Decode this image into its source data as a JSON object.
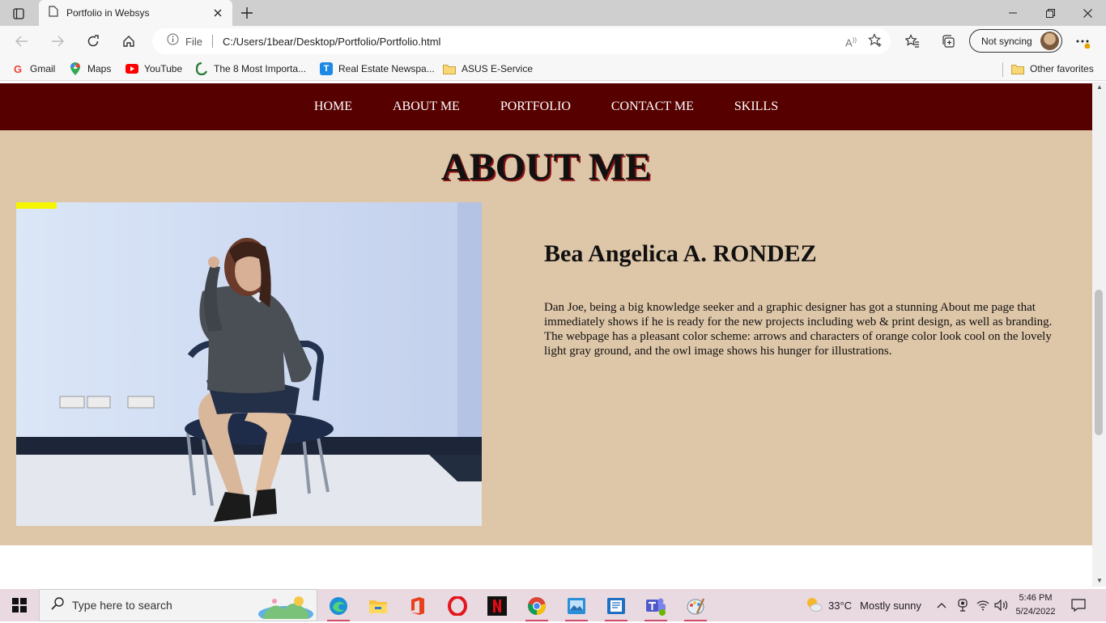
{
  "browser": {
    "tab_title": "Portfolio in Websys",
    "address_scheme": "File",
    "address_url": "C:/Users/1bear/Desktop/Portfolio/Portfolio.html",
    "sync_label": "Not syncing",
    "bookmarks": [
      {
        "label": "Gmail",
        "icon": "gmail-icon"
      },
      {
        "label": "Maps",
        "icon": "maps-icon"
      },
      {
        "label": "YouTube",
        "icon": "youtube-icon"
      },
      {
        "label": "The 8 Most Importa...",
        "icon": "site-icon"
      },
      {
        "label": "Real Estate Newspa...",
        "icon": "t-icon"
      },
      {
        "label": "ASUS E-Service",
        "icon": "folder-icon"
      }
    ],
    "other_favorites": "Other favorites"
  },
  "site": {
    "nav": [
      "HOME",
      "ABOUT ME",
      "PORTFOLIO",
      "CONTACT ME",
      "SKILLS"
    ],
    "about": {
      "title": "ABOUT ME",
      "name": "Bea Angelica A. RONDEZ",
      "bio": "Dan Joe, being a big knowledge seeker and a graphic designer has got a stunning About me page that immediately shows if he is ready for the new projects including web & print design, as well as branding. The webpage has a pleasant color scheme: arrows and characters of orange color look cool on the lovely light gray ground, and the owl image shows his hunger for illustrations."
    },
    "colors": {
      "nav_bg": "#570000",
      "about_bg": "#dec6a8"
    }
  },
  "taskbar": {
    "search_placeholder": "Type here to search",
    "weather_temp": "33°C",
    "weather_text": "Mostly sunny",
    "time": "5:46 PM",
    "date": "5/24/2022"
  }
}
